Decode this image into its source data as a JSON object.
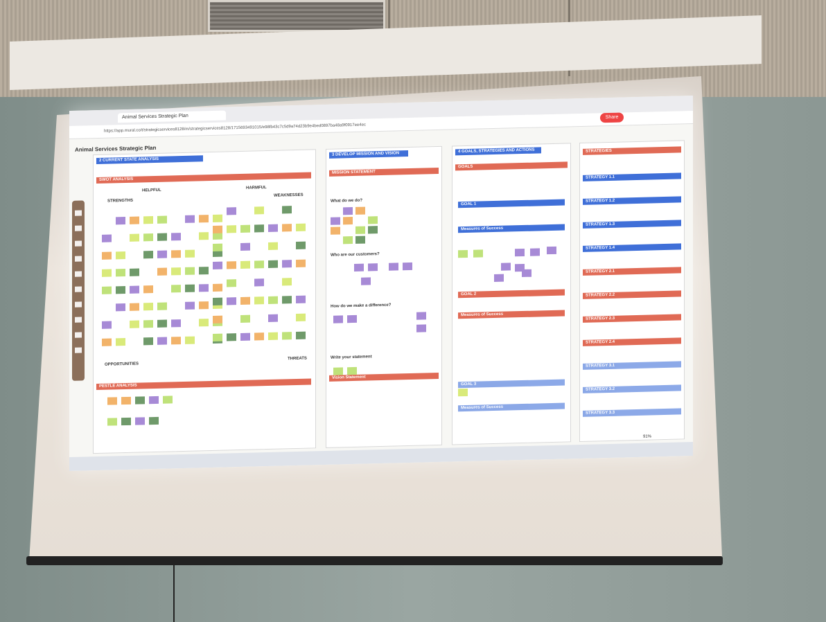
{
  "browser": {
    "tab_title": "Animal Services Strategic Plan",
    "url": "https://app.mural.co/t/strategicservices8128/m/strategicservices8128/1715693491015/e98fb43c7c5d9a74d23b9e4bed0897ba48a9f0917ee4ec",
    "share_label": "Share"
  },
  "app": {
    "title": "Animal Services Strategic Plan",
    "zoom": "91%"
  },
  "sections": {
    "current_state": {
      "number": "2",
      "title": "CURRENT STATE ANALYSIS",
      "swot_header": "SWOT ANALYSIS",
      "strengths": "STRENGTHS",
      "weaknesses": "WEAKNESSES",
      "opportunities": "OPPORTUNITIES",
      "threats": "THREATS",
      "helpful": "HELPFUL",
      "harmful": "HARMFUL",
      "pestle_header": "PESTLE ANALYSIS"
    },
    "mission": {
      "number": "3",
      "title": "DEVELOP MISSION AND VISION",
      "mission_header": "MISSION STATEMENT",
      "q1": "What do we do?",
      "q2": "Who are our customers?",
      "q3": "How do we make a difference?",
      "write": "Write your statement",
      "vision_header": "Vision Statement"
    },
    "goals": {
      "number": "4",
      "title": "GOALS, STRATEGIES AND ACTIONS",
      "goals_header": "GOALS",
      "goal1": "GOAL 1",
      "measures": "Measures of Success",
      "goal2": "GOAL 2",
      "goal3": "GOAL 3",
      "strategies_header": "STRATEGIES",
      "strategies": [
        "STRATEGY 1.1",
        "STRATEGY 1.2",
        "STRATEGY 1.3",
        "STRATEGY 1.4",
        "STRATEGY 2.1",
        "STRATEGY 2.2",
        "STRATEGY 2.3",
        "STRATEGY 2.4",
        "STRATEGY 3.1",
        "STRATEGY 3.2",
        "STRATEGY 3.3"
      ]
    }
  },
  "colors": {
    "blue": "#3f6fd8",
    "red": "#e06a55",
    "purple": "#a78ad6",
    "green": "#6f9a6a",
    "orange": "#f2b36a",
    "yellow": "#d9ea7a",
    "lime": "#bfe27a"
  }
}
